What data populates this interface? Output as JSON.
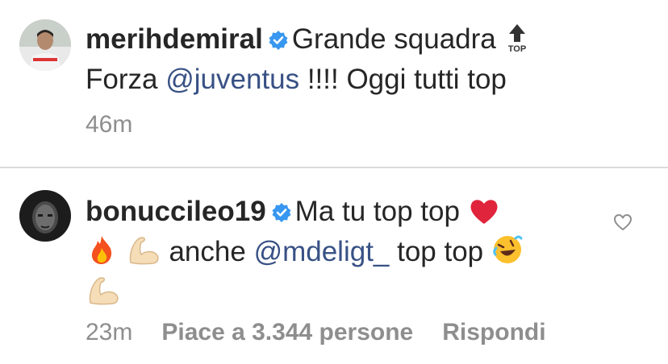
{
  "comments": [
    {
      "username": "merihdemiral",
      "text_part1": "Grande squadra",
      "line2_pre": "Forza ",
      "mention": "@juventus",
      "line2_post": " !!!! Oggi tutti top",
      "time": "46m",
      "top_emoji_label": "TOP"
    },
    {
      "username": "bonuccileo19",
      "text_part1": "Ma tu top top",
      "line2_pre": "anche ",
      "mention": "@mdeligt_",
      "line2_post": " top top",
      "time": "23m",
      "likes": "Piace a 3.344 persone",
      "reply": "Rispondi"
    }
  ],
  "colors": {
    "verified": "#3897f0",
    "mention": "#385185",
    "meta": "#8e8e8e"
  },
  "icons": [
    "verified-badge-icon",
    "top-arrow-emoji",
    "red-heart-emoji",
    "fire-emoji",
    "flexed-biceps-emoji",
    "rofl-emoji",
    "heart-outline-icon"
  ]
}
